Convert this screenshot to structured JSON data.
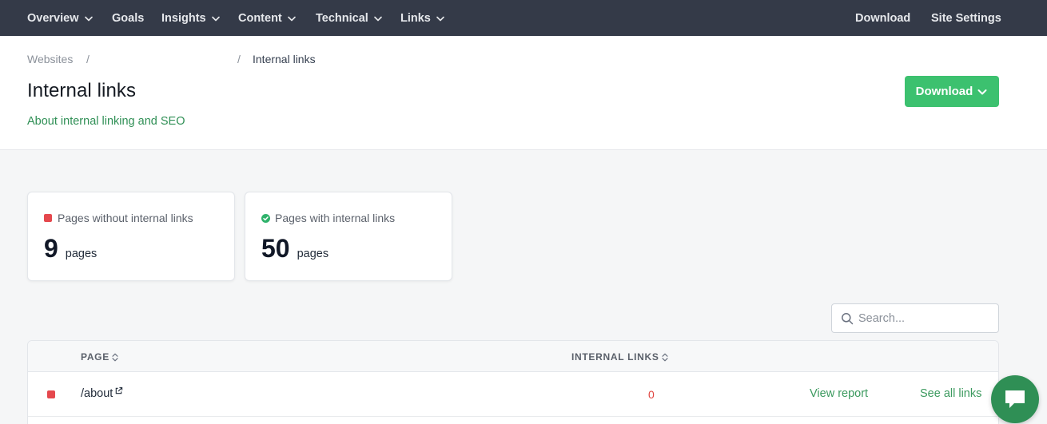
{
  "nav": {
    "left": [
      {
        "label": "Overview",
        "dropdown": true
      },
      {
        "label": "Goals",
        "dropdown": false
      },
      {
        "label": "Insights",
        "dropdown": true
      },
      {
        "label": "Content",
        "dropdown": true
      },
      {
        "label": "Technical",
        "dropdown": true
      },
      {
        "label": "Links",
        "dropdown": true
      }
    ],
    "right": [
      {
        "label": "Download"
      },
      {
        "label": "Site Settings"
      }
    ]
  },
  "breadcrumb": {
    "root": "Websites",
    "separator": "/",
    "site": "",
    "current": "Internal links"
  },
  "header": {
    "title": "Internal links",
    "about_link": "About internal linking and SEO",
    "download_button": "Download"
  },
  "stats": [
    {
      "label": "Pages without internal links",
      "value": "9",
      "unit": "pages",
      "status": "bad",
      "status_color": "#e5484d"
    },
    {
      "label": "Pages with internal links",
      "value": "50",
      "unit": "pages",
      "status": "good",
      "status_color": "#2fb26b"
    }
  ],
  "search": {
    "placeholder": "Search...",
    "value": ""
  },
  "table": {
    "columns": [
      "PAGE",
      "INTERNAL LINKS"
    ],
    "rows": [
      {
        "page": "/about",
        "internal_links": "0",
        "status": "bad",
        "view_report": "View report",
        "see_all": "See all links"
      }
    ]
  },
  "colors": {
    "nav_bg": "#343a48",
    "accent_green": "#3cc16f",
    "link_green": "#2f8f55",
    "danger_red": "#e5484d"
  },
  "icons": [
    "chevron-down-icon",
    "check-circle-icon",
    "search-icon",
    "sort-icon",
    "external-link-icon",
    "chat-icon"
  ]
}
